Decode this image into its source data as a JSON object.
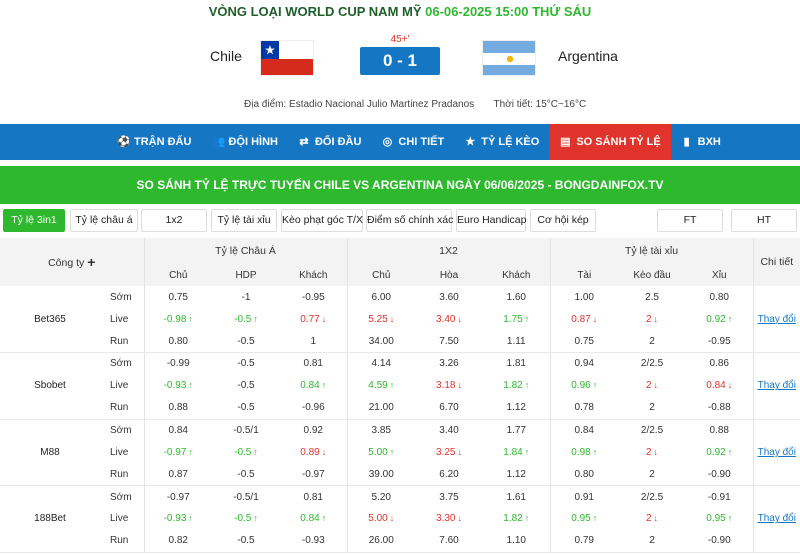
{
  "match": {
    "competition": "VÒNG LOẠI WORLD CUP NAM MỸ",
    "datetime": "06-06-2025 15:00 THỨ SÁU",
    "home": "Chile",
    "away": "Argentina",
    "minute": "45+'",
    "score": "0 - 1",
    "venue_label": "Địa điểm:",
    "venue": "Estadio Nacional Julio Martinez Pradanos",
    "weather_label": "Thời tiết:",
    "weather": "15°C~16°C"
  },
  "nav": [
    {
      "label": "TRẬN ĐẤU",
      "icon": "soccer-ball-icon"
    },
    {
      "label": "ĐỘI HÌNH",
      "icon": "team-icon"
    },
    {
      "label": "ĐỐI ĐẦU",
      "icon": "versus-icon"
    },
    {
      "label": "CHI TIẾT",
      "icon": "details-icon"
    },
    {
      "label": "TỶ LỆ KÈO",
      "icon": "star-icon"
    },
    {
      "label": "SO SÁNH TỶ LỆ",
      "icon": "compare-icon",
      "active": true
    },
    {
      "label": "BXH",
      "icon": "chart-icon"
    }
  ],
  "title": "SO SÁNH TỶ LỆ TRỰC TUYẾN CHILE VS ARGENTINA NGÀY 06/06/2025 - BONGDAINFOX.TV",
  "filters": [
    {
      "label": "Tỷ lệ 3in1",
      "active": true
    },
    {
      "label": "Tỷ lệ châu á"
    },
    {
      "label": "1x2"
    },
    {
      "label": "Tỷ lệ tài xỉu"
    },
    {
      "label": "Kèo phạt góc T/X"
    },
    {
      "label": "Điểm số chính xác"
    },
    {
      "label": "Euro Handicap"
    },
    {
      "label": "Cơ hội kép"
    },
    {
      "label": "FT"
    },
    {
      "label": "HT"
    }
  ],
  "table": {
    "company_header": "Công ty",
    "groups": [
      "Tỷ lệ Châu Á",
      "1X2",
      "Tỷ lệ tài xỉu"
    ],
    "detail_header": "Chi tiết",
    "sub_headers": [
      "Chủ",
      "HDP",
      "Khách",
      "Chủ",
      "Hòa",
      "Khách",
      "Tài",
      "Kèo đầu",
      "Xỉu"
    ],
    "phases": {
      "early": "Sớm",
      "live": "Live",
      "run": "Run"
    },
    "change_label": "Thay đổi",
    "books": [
      {
        "name": "Bet365",
        "rows": [
          {
            "phase": "early",
            "cells": [
              {
                "v": "0.75"
              },
              {
                "v": "-1"
              },
              {
                "v": "-0.95"
              },
              {
                "v": "6.00"
              },
              {
                "v": "3.60"
              },
              {
                "v": "1.60"
              },
              {
                "v": "1.00"
              },
              {
                "v": "2.5"
              },
              {
                "v": "0.80"
              }
            ]
          },
          {
            "phase": "live",
            "cells": [
              {
                "v": "-0.98",
                "d": "up"
              },
              {
                "v": "-0.5",
                "d": "up"
              },
              {
                "v": "0.77",
                "d": "down"
              },
              {
                "v": "5.25",
                "d": "down"
              },
              {
                "v": "3.40",
                "d": "down"
              },
              {
                "v": "1.75",
                "d": "up"
              },
              {
                "v": "0.87",
                "d": "down"
              },
              {
                "v": "2",
                "d": "down"
              },
              {
                "v": "0.92",
                "d": "up"
              }
            ]
          },
          {
            "phase": "run",
            "cells": [
              {
                "v": "0.80"
              },
              {
                "v": "-0.5"
              },
              {
                "v": "1"
              },
              {
                "v": "34.00"
              },
              {
                "v": "7.50"
              },
              {
                "v": "1.11"
              },
              {
                "v": "0.75"
              },
              {
                "v": "2"
              },
              {
                "v": "-0.95"
              }
            ]
          }
        ]
      },
      {
        "name": "Sbobet",
        "rows": [
          {
            "phase": "early",
            "cells": [
              {
                "v": "-0.99"
              },
              {
                "v": "-0.5"
              },
              {
                "v": "0.81"
              },
              {
                "v": "4.14"
              },
              {
                "v": "3.26"
              },
              {
                "v": "1.81"
              },
              {
                "v": "0.94"
              },
              {
                "v": "2/2.5"
              },
              {
                "v": "0.86"
              }
            ]
          },
          {
            "phase": "live",
            "cells": [
              {
                "v": "-0.93",
                "d": "up"
              },
              {
                "v": "-0.5"
              },
              {
                "v": "0.84",
                "d": "up"
              },
              {
                "v": "4.59",
                "d": "up"
              },
              {
                "v": "3.18",
                "d": "down"
              },
              {
                "v": "1.82",
                "d": "up"
              },
              {
                "v": "0.96",
                "d": "up"
              },
              {
                "v": "2",
                "d": "down"
              },
              {
                "v": "0.84",
                "d": "down"
              }
            ]
          },
          {
            "phase": "run",
            "cells": [
              {
                "v": "0.88"
              },
              {
                "v": "-0.5"
              },
              {
                "v": "-0.96"
              },
              {
                "v": "21.00"
              },
              {
                "v": "6.70"
              },
              {
                "v": "1.12"
              },
              {
                "v": "0.78"
              },
              {
                "v": "2"
              },
              {
                "v": "-0.88"
              }
            ]
          }
        ]
      },
      {
        "name": "M88",
        "rows": [
          {
            "phase": "early",
            "cells": [
              {
                "v": "0.84"
              },
              {
                "v": "-0.5/1"
              },
              {
                "v": "0.92"
              },
              {
                "v": "3.85"
              },
              {
                "v": "3.40"
              },
              {
                "v": "1.77"
              },
              {
                "v": "0.84"
              },
              {
                "v": "2/2.5"
              },
              {
                "v": "0.88"
              }
            ]
          },
          {
            "phase": "live",
            "cells": [
              {
                "v": "-0.97",
                "d": "up"
              },
              {
                "v": "-0.5",
                "d": "up"
              },
              {
                "v": "0.89",
                "d": "down"
              },
              {
                "v": "5.00",
                "d": "up"
              },
              {
                "v": "3.25",
                "d": "down"
              },
              {
                "v": "1.84",
                "d": "up"
              },
              {
                "v": "0.98",
                "d": "up"
              },
              {
                "v": "2",
                "d": "down"
              },
              {
                "v": "0.92",
                "d": "up"
              }
            ]
          },
          {
            "phase": "run",
            "cells": [
              {
                "v": "0.87"
              },
              {
                "v": "-0.5"
              },
              {
                "v": "-0.97"
              },
              {
                "v": "39.00"
              },
              {
                "v": "6.20"
              },
              {
                "v": "1.12"
              },
              {
                "v": "0.80"
              },
              {
                "v": "2"
              },
              {
                "v": "-0.90"
              }
            ]
          }
        ]
      },
      {
        "name": "188Bet",
        "rows": [
          {
            "phase": "early",
            "cells": [
              {
                "v": "-0.97"
              },
              {
                "v": "-0.5/1"
              },
              {
                "v": "0.81"
              },
              {
                "v": "5.20"
              },
              {
                "v": "3.75"
              },
              {
                "v": "1.61"
              },
              {
                "v": "0.91"
              },
              {
                "v": "2/2.5"
              },
              {
                "v": "-0.91"
              }
            ]
          },
          {
            "phase": "live",
            "cells": [
              {
                "v": "-0.93",
                "d": "up"
              },
              {
                "v": "-0.5",
                "d": "up"
              },
              {
                "v": "0.84",
                "d": "up"
              },
              {
                "v": "5.00",
                "d": "down"
              },
              {
                "v": "3.30",
                "d": "down"
              },
              {
                "v": "1.82",
                "d": "up"
              },
              {
                "v": "0.95",
                "d": "up"
              },
              {
                "v": "2",
                "d": "down"
              },
              {
                "v": "0.95",
                "d": "up"
              }
            ]
          },
          {
            "phase": "run",
            "cells": [
              {
                "v": "0.82"
              },
              {
                "v": "-0.5"
              },
              {
                "v": "-0.93"
              },
              {
                "v": "26.00"
              },
              {
                "v": "7.60"
              },
              {
                "v": "1.10"
              },
              {
                "v": "0.79"
              },
              {
                "v": "2"
              },
              {
                "v": "-0.90"
              }
            ]
          }
        ]
      }
    ]
  },
  "colors": {
    "brand_blue": "#1577c4",
    "active_red": "#e0332b",
    "green": "#2eb82e"
  }
}
